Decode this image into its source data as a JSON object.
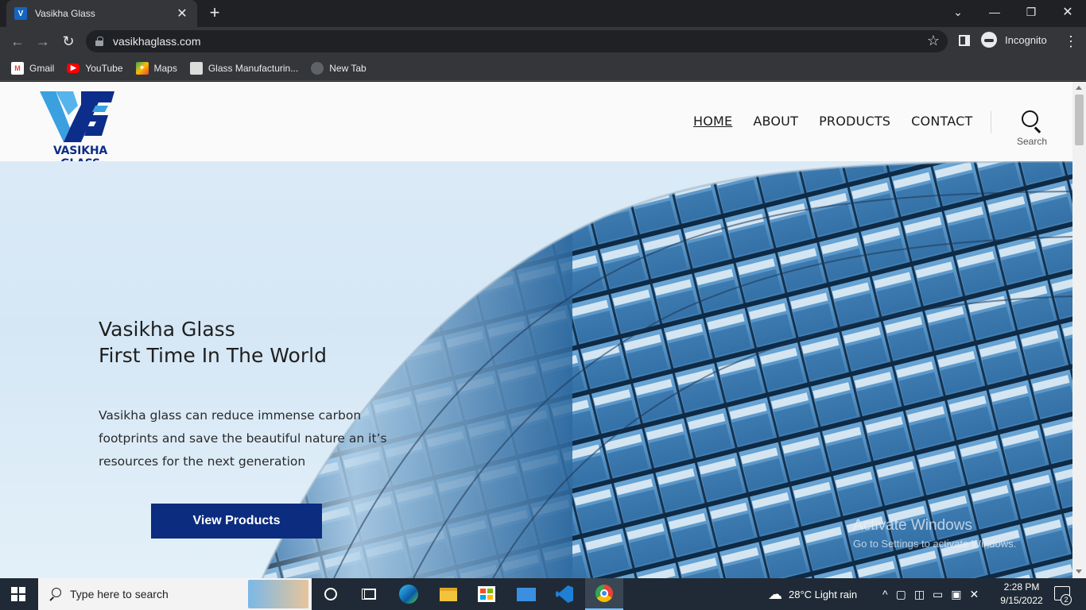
{
  "browser": {
    "tab_title": "Vasikha Glass",
    "tab_close": "✕",
    "new_tab": "+",
    "url": "vasikhaglass.com",
    "profile_label": "Incognito",
    "bookmarks": [
      {
        "label": "Gmail",
        "icon": "gmail-icon",
        "color": "#ea4335"
      },
      {
        "label": "YouTube",
        "icon": "youtube-icon",
        "color": "#ff0000"
      },
      {
        "label": "Maps",
        "icon": "maps-icon",
        "color": "#34a853"
      },
      {
        "label": "Glass Manufacturin...",
        "icon": "site-favicon",
        "color": "#9e9e9e"
      },
      {
        "label": "New Tab",
        "icon": "globe-icon",
        "color": "#5f6368"
      }
    ]
  },
  "site": {
    "logo_text": "VASIKHA GLASS",
    "nav": [
      {
        "label": "HOME",
        "active": true
      },
      {
        "label": "ABOUT",
        "active": false
      },
      {
        "label": "PRODUCTS",
        "active": false
      },
      {
        "label": "CONTACT",
        "active": false
      }
    ],
    "search_label": "Search",
    "hero": {
      "title_line1": "Vasikha Glass",
      "title_line2": "First Time In The World",
      "body": "Vasikha glass can reduce immense carbon footprints and save the beautiful nature an it’s resources for the next generation",
      "cta": "View Products"
    }
  },
  "watermark": {
    "line1": "Activate Windows",
    "line2": "Go to Settings to activate Windows."
  },
  "taskbar": {
    "search_placeholder": "Type here to search",
    "weather": "28°C  Light rain",
    "time": "2:28 PM",
    "date": "9/15/2022",
    "notification_count": "2"
  },
  "colors": {
    "brand_blue": "#0b2c7f",
    "logo_light_blue": "#3aa0e0",
    "chrome_dark": "#202124",
    "chrome_toolbar": "#35363a"
  }
}
